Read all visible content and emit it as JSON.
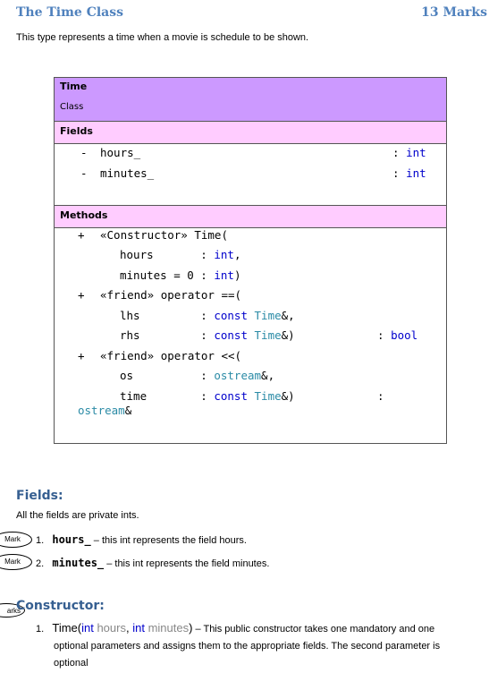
{
  "header": {
    "title": "The Time Class",
    "marks": "13 Marks"
  },
  "intro": "This type represents a time when a movie is schedule to be shown.",
  "uml": {
    "name": "Time",
    "kind": "Class",
    "fields_label": "Fields",
    "fields": [
      {
        "vis": "-",
        "name": "hours_",
        "type": "int"
      },
      {
        "vis": "-",
        "name": "minutes_",
        "type": "int"
      }
    ],
    "methods_label": "Methods",
    "methods": {
      "ctor": {
        "vis": "+",
        "sig": "«Constructor» Time(",
        "p1_name": "hours       : ",
        "p1_type": "int",
        "p1_end": ",",
        "p2_name": "minutes = 0 : ",
        "p2_type": "int",
        "p2_end": ")"
      },
      "eq": {
        "vis": "+",
        "sig": "«friend» operator ==(",
        "p1_name": "lhs         : ",
        "p1_kw": "const",
        "p1_type": "Time",
        "p1_end": "&,",
        "p2_name": "rhs         : ",
        "p2_kw": "const",
        "p2_type": "Time",
        "p2_end": "&)",
        "ret_sep": ": ",
        "ret": "bool"
      },
      "out": {
        "vis": "+",
        "sig": "«friend» operator <<(",
        "p1_name": "os          : ",
        "p1_type": "ostream",
        "p1_end": "&,",
        "p2_name": "time        : ",
        "p2_kw": "const",
        "p2_type": "Time",
        "p2_end": "&)",
        "ret_sep": ":",
        "ret": "ostream",
        "ret_end": "&"
      }
    }
  },
  "fields_section": {
    "heading": "Fields:",
    "desc": "All the fields are private ints.",
    "items": [
      {
        "mark": "Mark",
        "num": "1.",
        "name": "hours_",
        "desc": " – this int represents the field hours."
      },
      {
        "mark": "Mark",
        "num": "2.",
        "name": "minutes_",
        "desc": " – this int represents the field minutes."
      }
    ]
  },
  "ctor_section": {
    "mark": "arks",
    "heading": "Constructor:",
    "items": [
      {
        "num": "1.",
        "name": "Time(",
        "t1": "int",
        "a1": " hours",
        "sep": ", ",
        "t2": "int",
        "a2": " minutes",
        "close": ")",
        "desc": " – This public constructor takes one mandatory and one",
        "line2": "optional parameters and assigns them to the appropriate fields. The second parameter is",
        "line3": "optional"
      }
    ]
  }
}
